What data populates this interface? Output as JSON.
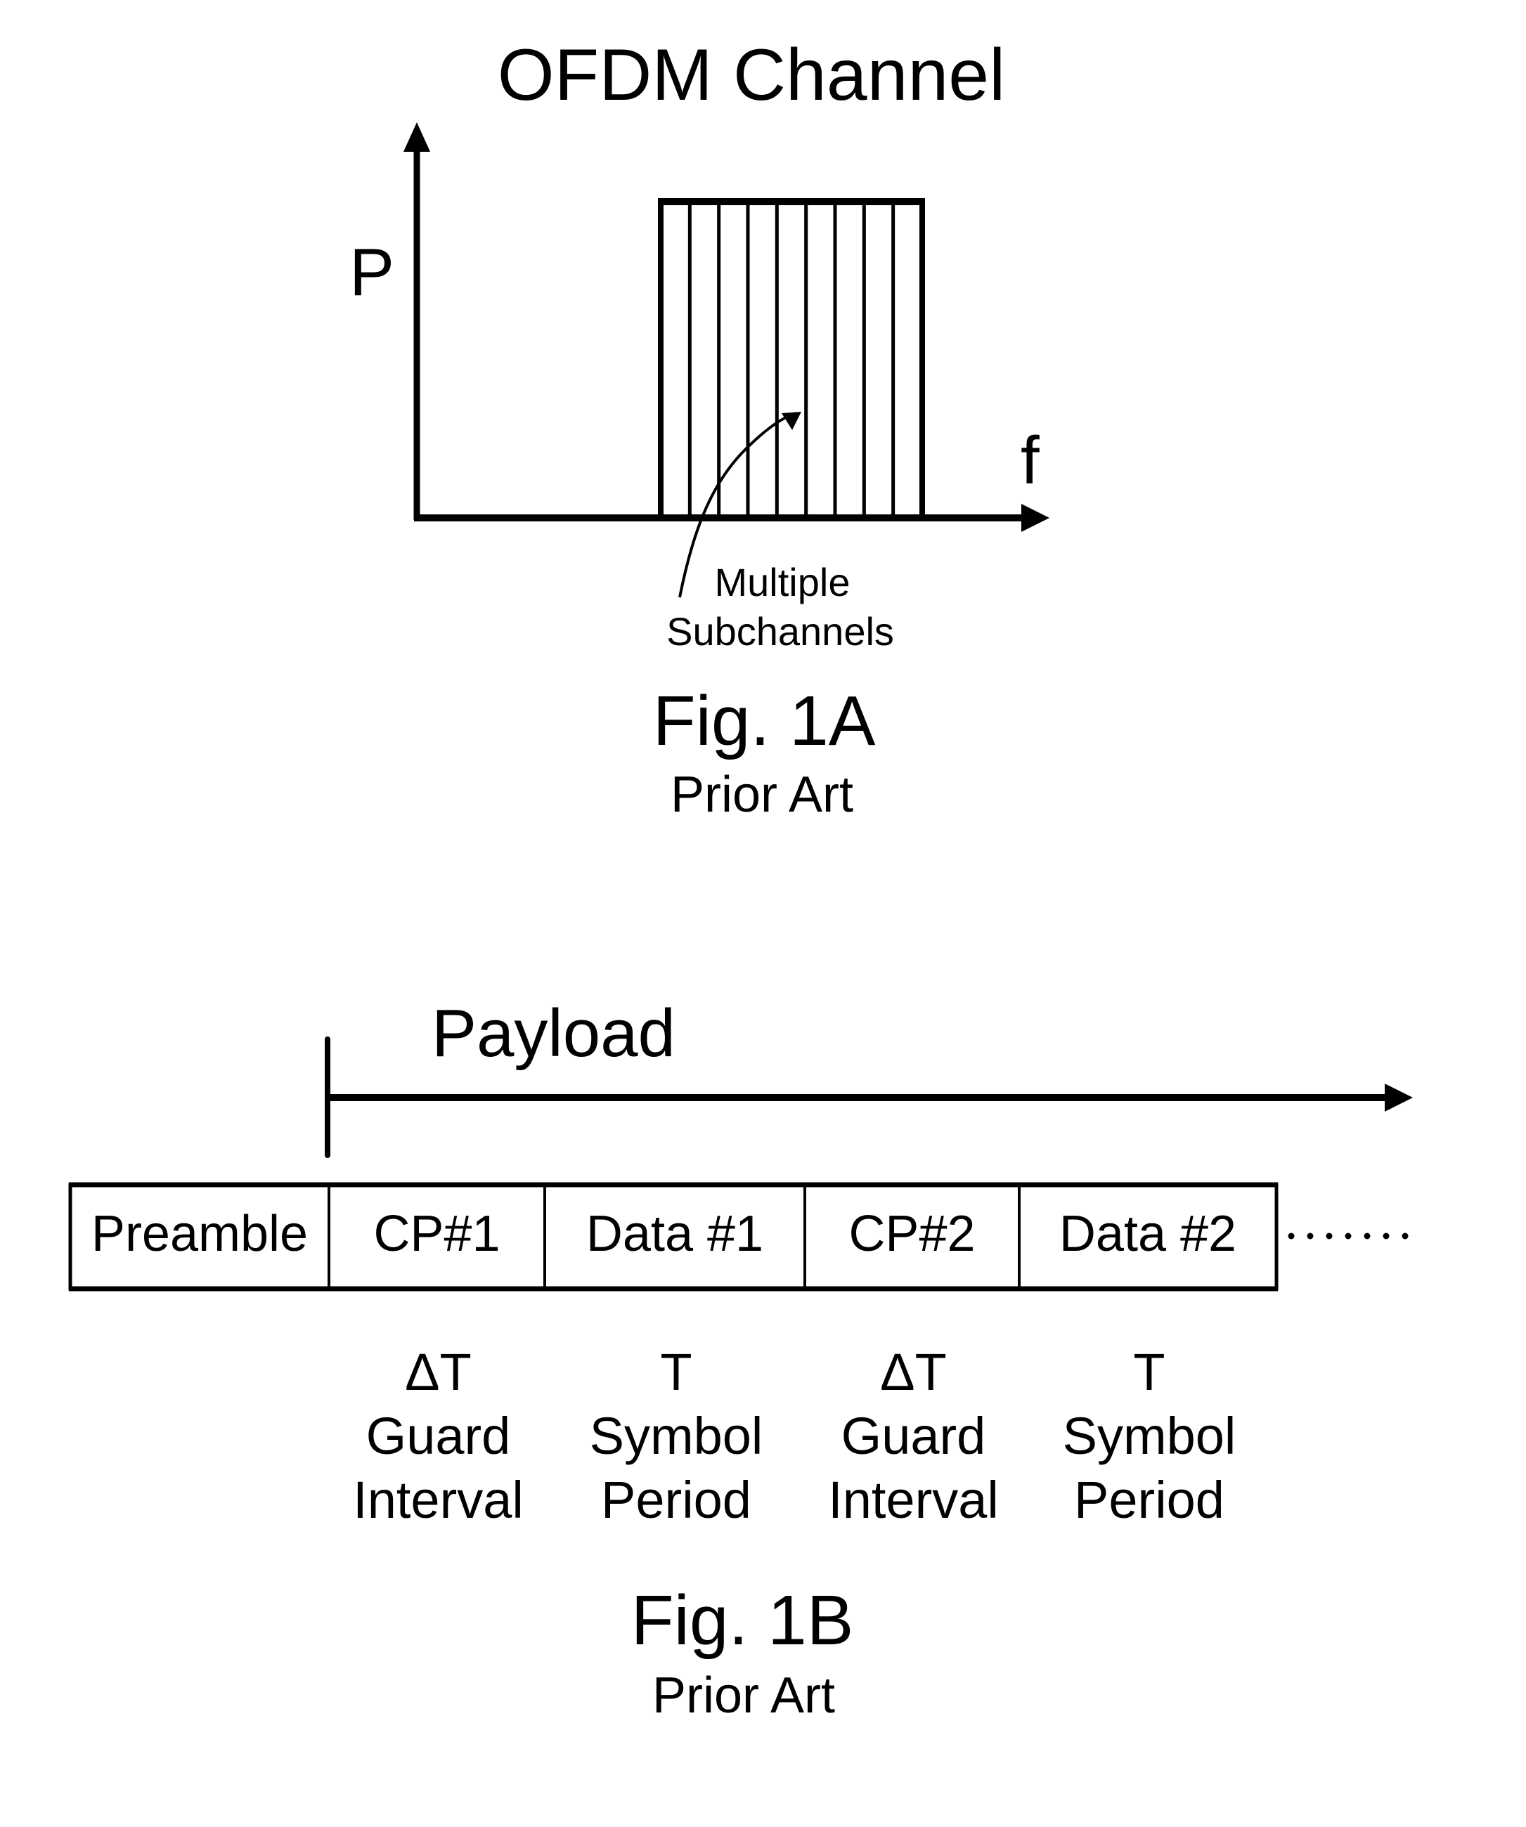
{
  "figure_a": {
    "title": "OFDM Channel",
    "y_axis_label": "P",
    "x_axis_label": "f",
    "subchannel_count": 9,
    "annotation_lines": [
      "Multiple",
      "Subchannels"
    ],
    "caption": "Fig. 1A",
    "caption_sub": "Prior Art"
  },
  "figure_b": {
    "payload_label": "Payload",
    "cells": [
      {
        "label": "Preamble",
        "below": []
      },
      {
        "label": "CP#1",
        "below": [
          "ΔT",
          "Guard",
          "Interval"
        ]
      },
      {
        "label": "Data #1",
        "below": [
          "T",
          "Symbol",
          "Period"
        ]
      },
      {
        "label": "CP#2",
        "below": [
          "ΔT",
          "Guard",
          "Interval"
        ]
      },
      {
        "label": "Data #2",
        "below": [
          "T",
          "Symbol",
          "Period"
        ]
      }
    ],
    "continuation_dots": 7,
    "caption": "Fig. 1B",
    "caption_sub": "Prior Art"
  },
  "colors": {
    "ink": "#000000",
    "background": "#ffffff"
  }
}
